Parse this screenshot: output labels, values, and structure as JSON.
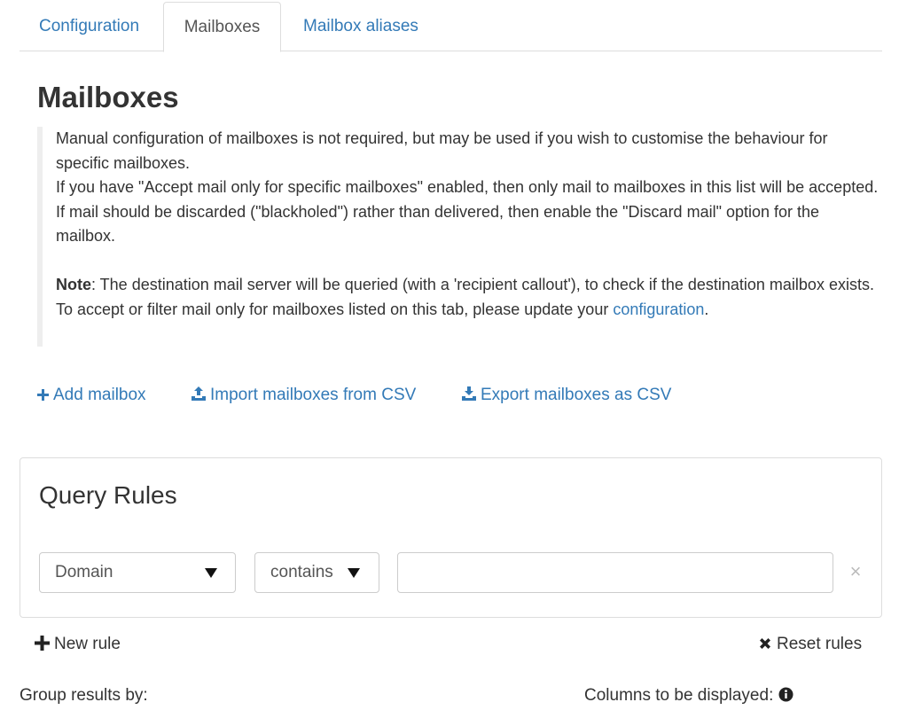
{
  "tabs": [
    {
      "label": "Configuration",
      "active": false
    },
    {
      "label": "Mailboxes",
      "active": true
    },
    {
      "label": "Mailbox aliases",
      "active": false
    }
  ],
  "page_title": "Mailboxes",
  "info": {
    "line1": "Manual configuration of mailboxes is not required, but may be used if you wish to customise the behaviour for specific mailboxes.",
    "line2": "If you have \"Accept mail only for specific mailboxes\" enabled, then only mail to mailboxes in this list will be accepted. If mail should be discarded (\"blackholed\") rather than delivered, then enable the \"Discard mail\" option for the mailbox.",
    "note_bold": "Note",
    "note_text": ": The destination mail server will be queried (with a 'recipient callout'), to check if the destination mailbox exists. To accept or filter mail only for mailboxes listed on this tab, please update your ",
    "note_link": "configuration",
    "note_end": "."
  },
  "actions": {
    "add": "Add mailbox",
    "import": "Import mailboxes from CSV",
    "export": "Export mailboxes as CSV"
  },
  "query_rules": {
    "title": "Query Rules",
    "field_selected": "Domain",
    "operator_selected": "contains",
    "value": "",
    "remove_symbol": "×"
  },
  "rule_buttons": {
    "new_rule": "New rule",
    "reset_rules": "Reset rules"
  },
  "footer": {
    "group_by": "Group results by:",
    "columns": "Columns to be displayed:"
  },
  "icons": {
    "add": "plus-icon",
    "import": "upload-icon",
    "export": "download-icon",
    "new_rule": "plus-icon",
    "reset": "times-icon",
    "columns_info": "info-circle-icon"
  },
  "colors": {
    "link": "#337ab7",
    "text": "#333333",
    "border": "#dddddd"
  }
}
